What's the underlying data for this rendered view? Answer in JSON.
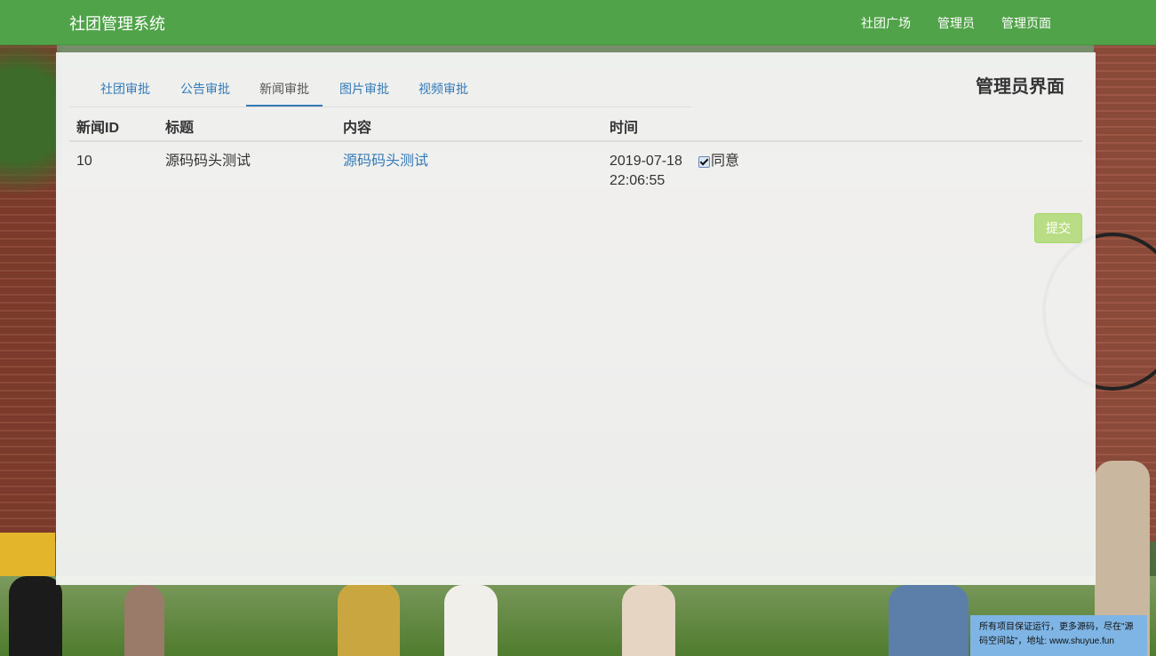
{
  "navbar": {
    "brand": "社团管理系统",
    "links": [
      "社团广场",
      "管理员",
      "管理页面"
    ]
  },
  "panel": {
    "title": "管理员界面",
    "tabs": [
      {
        "label": "社团审批",
        "active": false
      },
      {
        "label": "公告审批",
        "active": false
      },
      {
        "label": "新闻审批",
        "active": true
      },
      {
        "label": "图片审批",
        "active": false
      },
      {
        "label": "视频审批",
        "active": false
      }
    ],
    "table": {
      "headers": [
        "新闻ID",
        "标题",
        "内容",
        "时间"
      ],
      "rows": [
        {
          "id": "10",
          "title": "源码码头测试",
          "content": "源码码头测试",
          "time": "2019-07-18 22:06:55",
          "agree_label": "同意",
          "agree_checked": true
        }
      ]
    },
    "submit_label": "提交"
  },
  "footer_note": "所有项目保证运行，更多源码，尽在\"源码空间站\"，地址: www.shuyue.fun",
  "colors": {
    "navbar": "#4ca546",
    "link": "#337ab7",
    "submit": "#b9dd85",
    "footer_note_bg": "#7fb5e4"
  }
}
